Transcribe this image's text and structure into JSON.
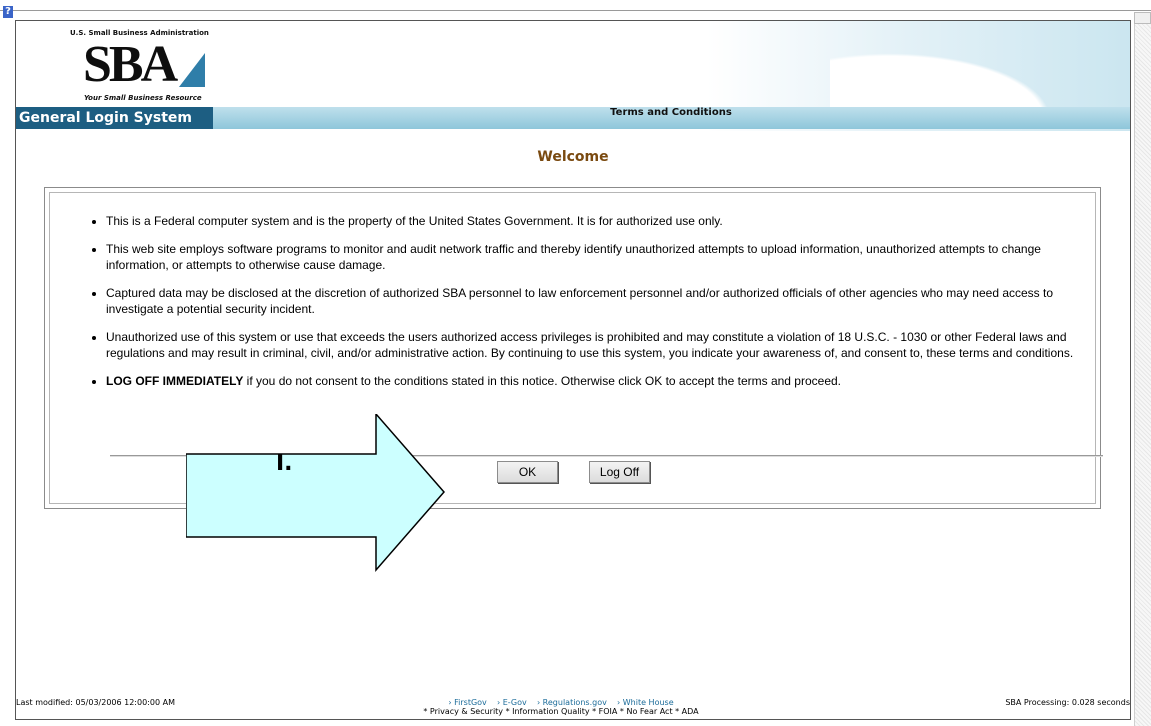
{
  "header": {
    "agency_line": "U.S. Small Business Administration",
    "logo_text": "SBA",
    "tagline": "Your Small Business Resource",
    "system_name": "General Login System",
    "page_title": "Terms and Conditions"
  },
  "welcome": "Welcome",
  "terms": [
    "This is a Federal computer system and is the property of the United States Government. It is for authorized use only.",
    "This web site employs software programs to monitor and audit network traffic and thereby identify unauthorized attempts to upload information, unauthorized attempts to change information, or attempts to otherwise cause damage.",
    "Captured data may be disclosed at the discretion of authorized SBA personnel to law enforcement personnel and/or authorized officials of other agencies who may need access to investigate a potential security incident.",
    "Unauthorized use of this system or use that exceeds the users authorized access privileges is prohibited and may constitute a violation of 18 U.S.C. - 1030 or other Federal laws and regulations and may result in criminal, civil, and/or administrative action. By continuing to use this system, you indicate your awareness of, and consent to, these terms and conditions."
  ],
  "last_term": {
    "bold": "LOG OFF IMMEDIATELY",
    "rest": " if you do not consent to the conditions stated in this notice. Otherwise click OK to accept the terms and proceed."
  },
  "buttons": {
    "ok": "OK",
    "log_off": "Log Off"
  },
  "annotation": {
    "label": "I."
  },
  "footer": {
    "last_modified": "Last modified: 05/03/2006 12:00:00 AM",
    "links": [
      "› FirstGov",
      "› E-Gov",
      "› Regulations.gov",
      "› White House"
    ],
    "policies": "* Privacy & Security  * Information Quality  * FOIA  * No Fear Act  * ADA",
    "processing": "SBA Processing:  0.028 seconds"
  },
  "colors": {
    "nav_dark": "#1d5e82",
    "welcome": "#7a4a10",
    "arrow_fill": "#ccffff"
  }
}
